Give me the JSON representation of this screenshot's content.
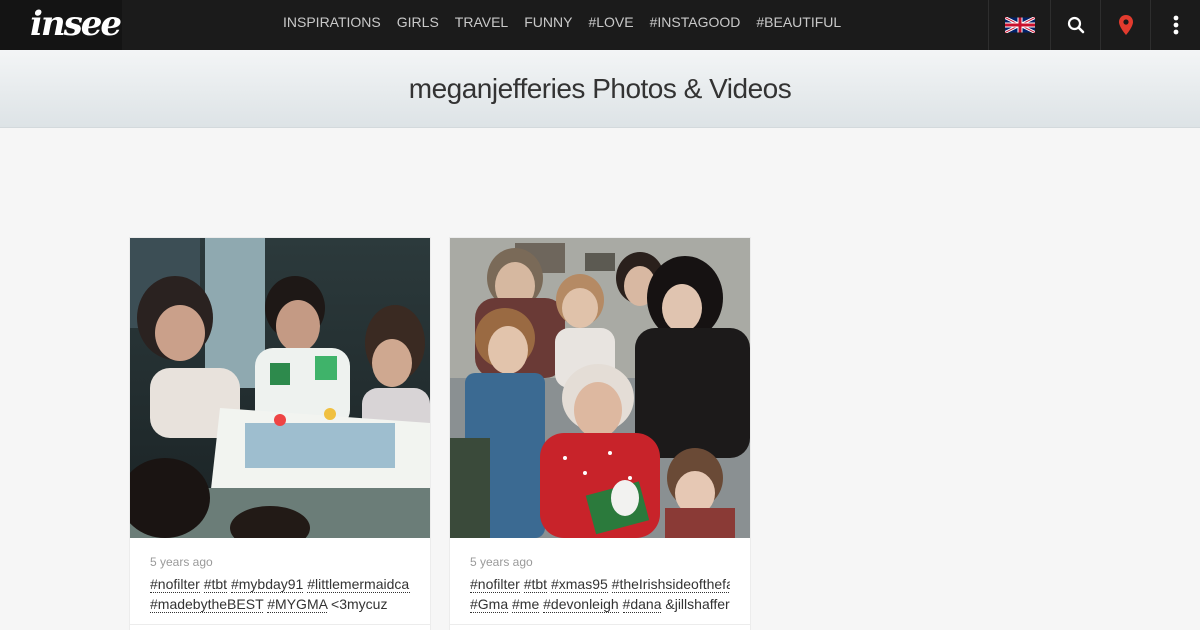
{
  "brand": {
    "logo": "insee"
  },
  "nav": {
    "items": [
      "INSPIRATIONS",
      "GIRLS",
      "TRAVEL",
      "FUNNY",
      "#LOVE",
      "#INSTAGOOD",
      "#BEAUTIFUL"
    ]
  },
  "tools": {
    "language_icon": "uk-flag-icon",
    "search_icon": "search-icon",
    "location_icon": "map-pin-icon",
    "menu_icon": "more-vertical-icon"
  },
  "colors": {
    "topbar": "#1b1b1b",
    "pin": "#e23b2e",
    "background": "#f6f6f6"
  },
  "page": {
    "title": "meganjefferies Photos & Videos"
  },
  "posts": [
    {
      "time": "5 years ago",
      "line1": [
        {
          "t": "#nofilter",
          "tag": true
        },
        {
          "t": " ",
          "tag": false
        },
        {
          "t": "#tbt",
          "tag": true
        },
        {
          "t": " ",
          "tag": false
        },
        {
          "t": "#mybday91",
          "tag": true
        },
        {
          "t": " ",
          "tag": false
        },
        {
          "t": "#littlemermaidcake",
          "tag": true
        }
      ],
      "line2": [
        {
          "t": "#madebytheBEST",
          "tag": true
        },
        {
          "t": " ",
          "tag": false
        },
        {
          "t": "#MYGMA",
          "tag": true
        },
        {
          "t": " <3mycuz",
          "tag": false
        }
      ]
    },
    {
      "time": "5 years ago",
      "line1": [
        {
          "t": "#nofilter",
          "tag": true
        },
        {
          "t": " ",
          "tag": false
        },
        {
          "t": "#tbt",
          "tag": true
        },
        {
          "t": " ",
          "tag": false
        },
        {
          "t": "#xmas95",
          "tag": true
        },
        {
          "t": " ",
          "tag": false
        },
        {
          "t": "#theIrishsideofthefamily",
          "tag": true
        }
      ],
      "line2": [
        {
          "t": "#Gma",
          "tag": true
        },
        {
          "t": " ",
          "tag": false
        },
        {
          "t": "#me",
          "tag": true
        },
        {
          "t": " ",
          "tag": false
        },
        {
          "t": "#devonleigh",
          "tag": true
        },
        {
          "t": " ",
          "tag": false
        },
        {
          "t": "#dana",
          "tag": true
        },
        {
          "t": " &jillshaffer",
          "tag": false
        }
      ]
    }
  ]
}
